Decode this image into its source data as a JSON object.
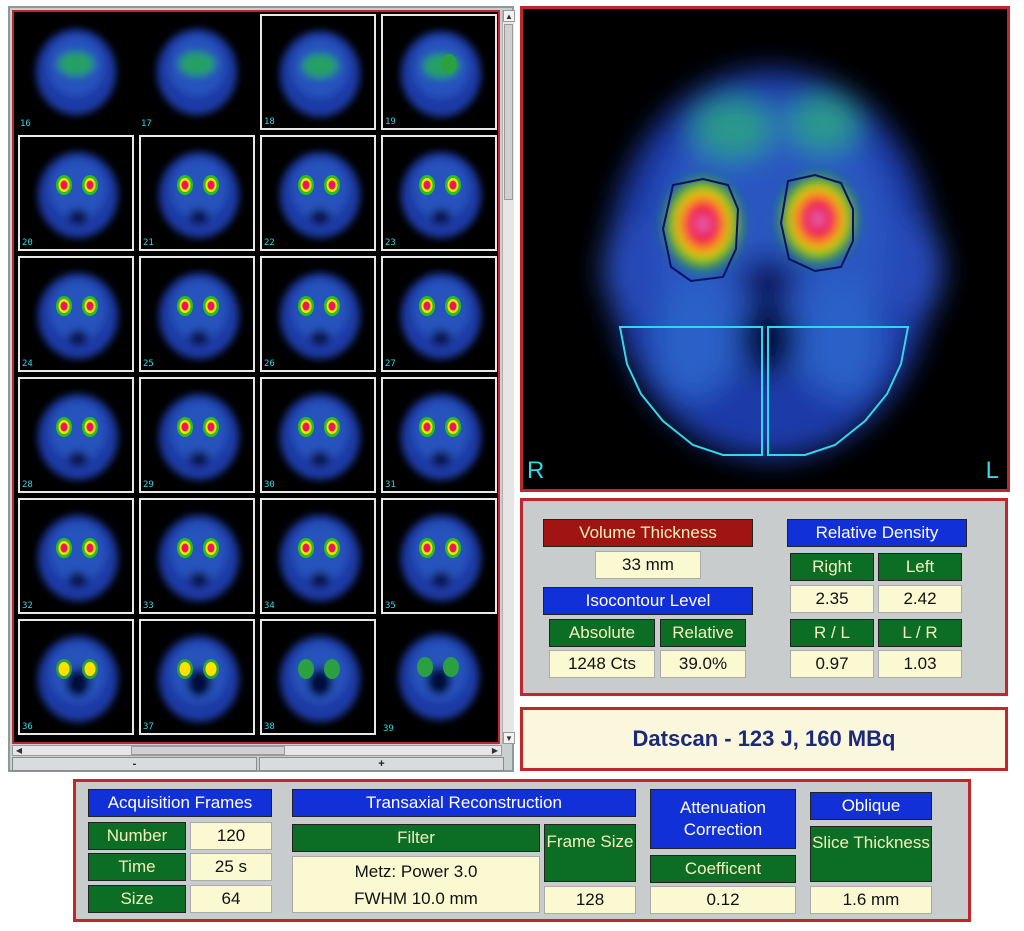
{
  "thumbnails": [
    {
      "num": "16",
      "selected": false
    },
    {
      "num": "17",
      "selected": false
    },
    {
      "num": "18",
      "selected": true
    },
    {
      "num": "19",
      "selected": true
    },
    {
      "num": "20",
      "selected": true
    },
    {
      "num": "21",
      "selected": true
    },
    {
      "num": "22",
      "selected": true
    },
    {
      "num": "23",
      "selected": true
    },
    {
      "num": "24",
      "selected": true
    },
    {
      "num": "25",
      "selected": true
    },
    {
      "num": "26",
      "selected": true
    },
    {
      "num": "27",
      "selected": true
    },
    {
      "num": "28",
      "selected": true
    },
    {
      "num": "29",
      "selected": true
    },
    {
      "num": "30",
      "selected": true
    },
    {
      "num": "31",
      "selected": true
    },
    {
      "num": "32",
      "selected": true
    },
    {
      "num": "33",
      "selected": true
    },
    {
      "num": "34",
      "selected": true
    },
    {
      "num": "35",
      "selected": true
    },
    {
      "num": "36",
      "selected": true
    },
    {
      "num": "37",
      "selected": true
    },
    {
      "num": "38",
      "selected": true
    },
    {
      "num": "39",
      "selected": false
    }
  ],
  "grid_controls": {
    "minus": "-",
    "plus": "+"
  },
  "main_image": {
    "right_label": "R",
    "left_label": "L"
  },
  "measurements": {
    "volume_thickness_label": "Volume Thickness",
    "volume_thickness_value": "33 mm",
    "isocontour_label": "Isocontour Level",
    "absolute_label": "Absolute",
    "absolute_value": "1248 Cts",
    "relative_label": "Relative",
    "relative_value": "39.0%",
    "relative_density_label": "Relative Density",
    "right_label": "Right",
    "right_value": "2.35",
    "left_label": "Left",
    "left_value": "2.42",
    "rl_label": "R / L",
    "rl_value": "0.97",
    "lr_label": "L / R",
    "lr_value": "1.03"
  },
  "banner": {
    "text": "Datscan - 123 J,  160 MBq"
  },
  "acquisition": {
    "header": "Acquisition Frames",
    "number_label": "Number",
    "number_value": "120",
    "time_label": "Time",
    "time_value": "25 s",
    "size_label": "Size",
    "size_value": "64"
  },
  "reconstruction": {
    "header": "Transaxial Reconstruction",
    "filter_label": "Filter",
    "filter_value_1": "Metz:  Power 3.0",
    "filter_value_2": "FWHM 10.0 mm",
    "frame_size_label": "Frame Size",
    "frame_size_value": "128"
  },
  "attenuation": {
    "header": "Attenuation Correction",
    "coefficient_label": "Coefficent",
    "coefficient_value": "0.12"
  },
  "oblique": {
    "header": "Oblique",
    "slice_label": "Slice Thickness",
    "slice_value": "1.6 mm"
  },
  "colors": {
    "panel_border": "#c0262c",
    "label_red": "#a01414",
    "label_blue": "#1230d8",
    "label_green": "#0c6e24",
    "value_bg": "#fbf9d2",
    "roi_cyan": "#35d6e6"
  }
}
